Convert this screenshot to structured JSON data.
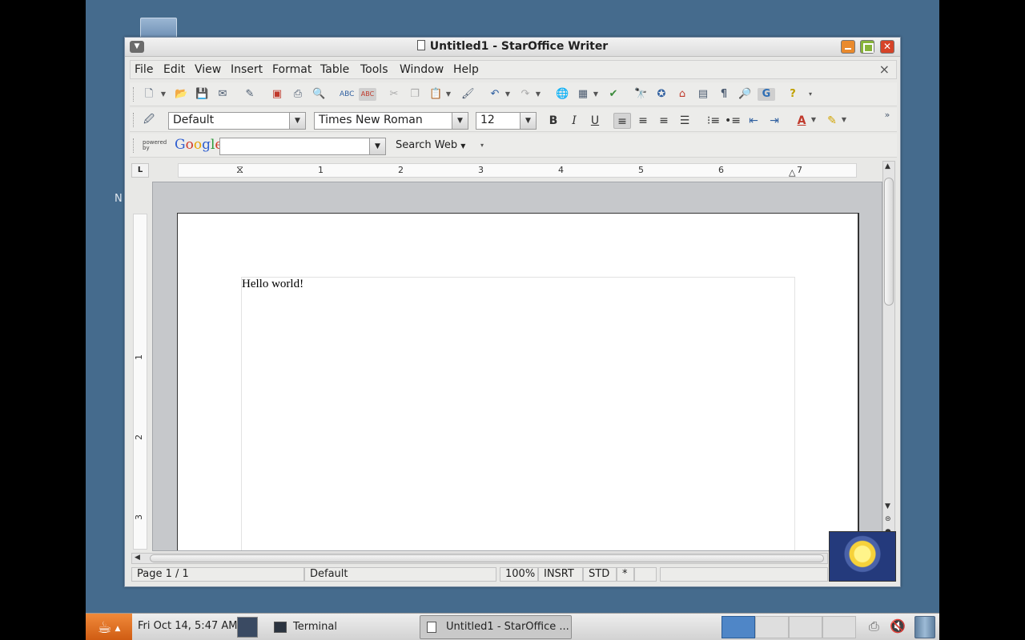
{
  "desktop": {
    "edge_letter": "N"
  },
  "window": {
    "title": "Untitled1 - StarOffice Writer",
    "close_glyph": "✕"
  },
  "menubar": {
    "items": [
      "File",
      "Edit",
      "View",
      "Insert",
      "Format",
      "Table",
      "Tools",
      "Window",
      "Help"
    ],
    "doc_close": "×"
  },
  "standard_toolbar": {
    "icons": [
      "new-icon",
      "open-icon",
      "save-icon",
      "email-icon",
      "edit-file-icon",
      "export-pdf-icon",
      "print-icon",
      "page-preview-icon",
      "spellcheck-icon",
      "autospellcheck-icon",
      "cut-icon",
      "copy-icon",
      "paste-icon",
      "format-paintbrush-icon",
      "undo-icon",
      "redo-icon",
      "hyperlink-icon",
      "table-icon",
      "show-draw-functions-icon",
      "find-replace-icon",
      "navigator-icon",
      "gallery-icon",
      "data-sources-icon",
      "nonprinting-characters-icon",
      "zoom-icon",
      "google-icon",
      "help-icon"
    ]
  },
  "formatting_toolbar": {
    "style": "Default",
    "font": "Times New Roman",
    "size": "12",
    "bold": "B",
    "italic": "I",
    "underline": "U"
  },
  "google_toolbar": {
    "powered_by": "powered by",
    "brand": "Google",
    "query": "",
    "search_label": "Search Web"
  },
  "ruler": {
    "corner": "L",
    "h_numbers": [
      "1",
      "2",
      "3",
      "4",
      "5",
      "6",
      "7"
    ],
    "v_numbers": [
      "1",
      "2",
      "3"
    ]
  },
  "document": {
    "text": "Hello world!"
  },
  "statusbar": {
    "page": "Page 1 / 1",
    "page_style": "Default",
    "zoom": "100%",
    "insert_mode": "INSRT",
    "selection_mode": "STD",
    "modified": "*"
  },
  "taskbar": {
    "clock": "Fri Oct 14,  5:47 AM",
    "tasks": [
      {
        "label": "Terminal",
        "active": false
      },
      {
        "label": "Untitled1 - StarOffice ...",
        "active": true
      }
    ],
    "colors": {
      "java_button": "#e07a2a",
      "current_workspace": "#4f86c7"
    }
  }
}
